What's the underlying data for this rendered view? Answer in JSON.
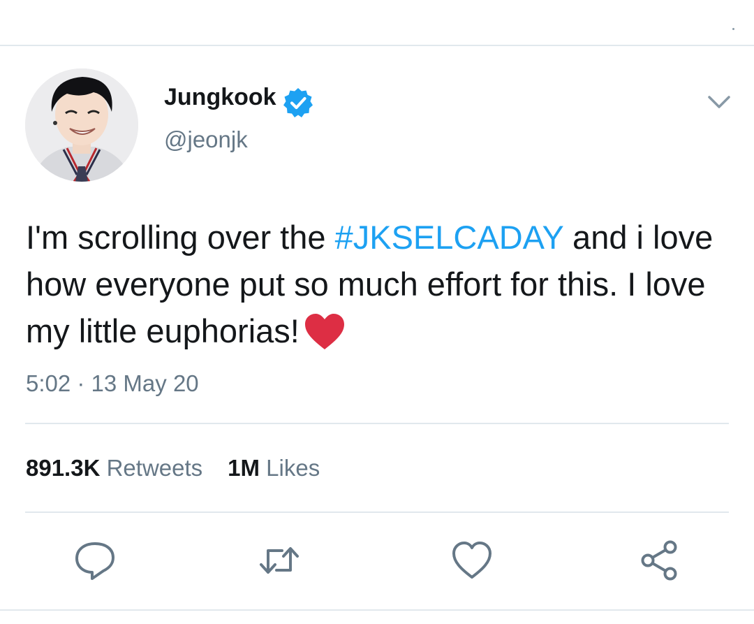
{
  "tweet": {
    "author": {
      "display_name": "Jungkook",
      "handle": "@jeonjk",
      "verified": true,
      "avatar_icon": "profile-photo"
    },
    "text": {
      "before_hashtag": "I'm scrolling over the ",
      "hashtag": "#JKSELCADAY",
      "after_hashtag": " and i love how everyone put so much effort for this. I love my little euphorias!",
      "emoji": "red-heart"
    },
    "timestamp": "5:02 · 13 May 20",
    "stats": {
      "retweets_count": "891.3K",
      "retweets_label": "Retweets",
      "likes_count": "1M",
      "likes_label": "Likes"
    },
    "actions": [
      {
        "name": "reply",
        "icon": "comment-bubble-icon"
      },
      {
        "name": "retweet",
        "icon": "retweet-arrows-icon"
      },
      {
        "name": "like",
        "icon": "heart-outline-icon"
      },
      {
        "name": "share",
        "icon": "share-nodes-icon"
      }
    ]
  },
  "colors": {
    "text_primary": "#14171a",
    "text_secondary": "#657786",
    "accent": "#1da1f2",
    "icon_gray": "#657786",
    "divider": "#e1e8ed",
    "heart_red": "#dd2e44"
  }
}
